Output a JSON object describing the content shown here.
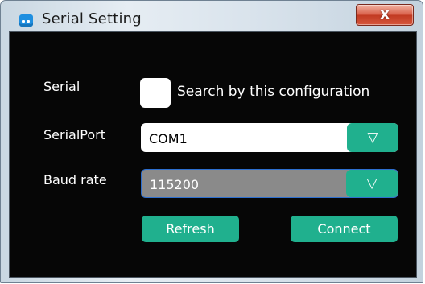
{
  "window": {
    "title": "Serial Setting",
    "close_glyph": "x"
  },
  "form": {
    "serial_label": "Serial",
    "search_checkbox_label": "Search by this configuration",
    "search_checked": false,
    "serialport_label": "SerialPort",
    "serialport_value": "COM1",
    "baud_label": "Baud rate",
    "baud_value": "115200",
    "dropdown_glyph": "▽"
  },
  "buttons": {
    "refresh": "Refresh",
    "connect": "Connect"
  },
  "colors": {
    "accent": "#20b08e",
    "panel_bg": "#060606",
    "baud_field_bg": "#8a8a8a",
    "focus_border": "#2d6fd0"
  }
}
